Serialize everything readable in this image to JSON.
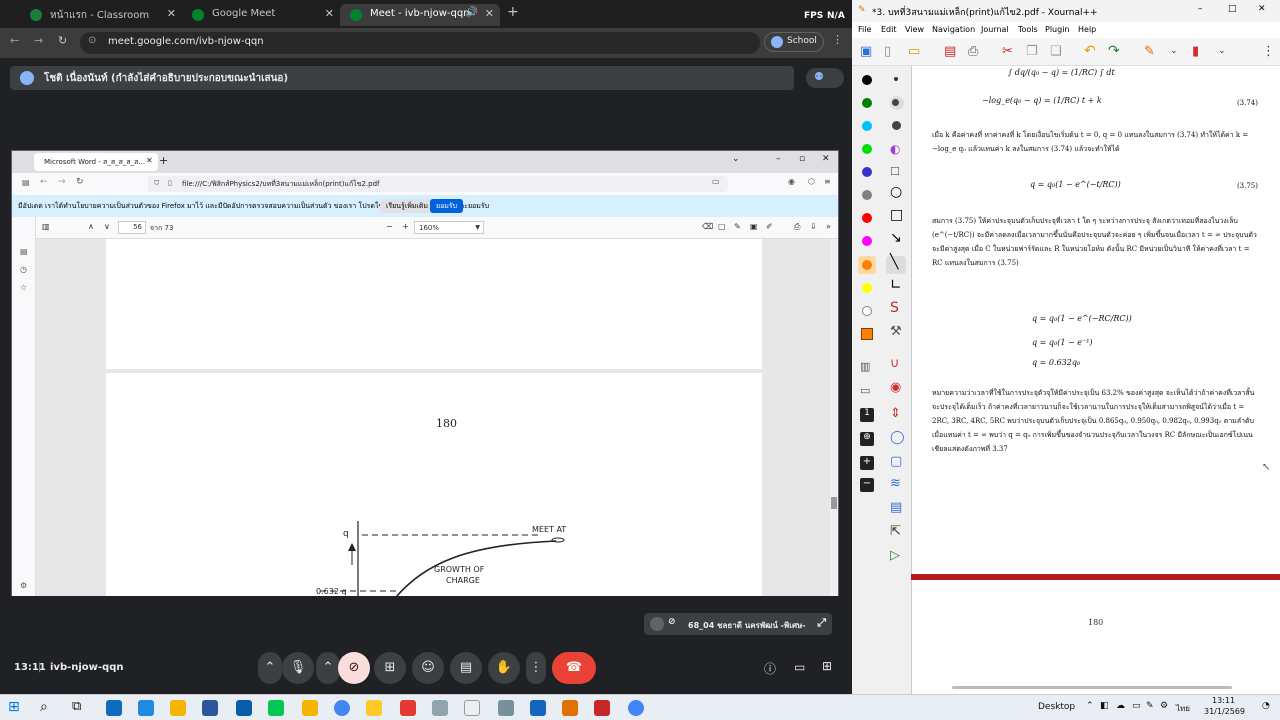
{
  "browser": {
    "tabs": [
      {
        "label": "หน้าแรก - Classroom",
        "fav_color": "#188038"
      },
      {
        "label": "Google Meet",
        "fav_color": "#00832d"
      },
      {
        "label": "Meet - ivb-njow-qqn",
        "fav_color": "#00832d"
      }
    ],
    "new_tab": "+",
    "url": "meet.google.com/ivb-njow-qqn",
    "profile": "School",
    "fps_label": "FPS",
    "fps_value": "N/A"
  },
  "meet": {
    "presenter_banner": "โชติ เนื่องนันท์ (กำลังไส่คำอธิบายประกอบขณะนำเสนอ)",
    "time": "13:11",
    "meeting_code": "ivb-njow-qqn",
    "self_tile": "68_04 ชลธาดี นครพัฒน์ -พิเศษ-"
  },
  "shared_window": {
    "tab_label": "Microsoft Word - ส_ส_ส_ส_ส...",
    "file_url": "file:///C:/ฟิสิกส์Physics2/บทที่3สนามแม่เหล็ก(print)แก้ไข2.pdf",
    "notice": "มีอัปเดต เราได้ทำนโยบายความเป็นส่วนตัวของ Firefox มาไว้ และมีปัดอัปการตรวจสอบความเป็นส่วนตัว ของเรา โปรดใช้เวลาศึกษาเพื่อตรวจสอบและยอมรับ",
    "notice_btn1": "เรียนรู้เพิ่มเติม",
    "notice_btn2": "ยอมรับ",
    "page_num": "56",
    "page_total": "จาก 73",
    "zoom": "160%",
    "page_number_label": "180",
    "graph_label_q0": "q",
    "graph_label_meet": "MEET AT",
    "graph_label_growth": "GROWTH OF",
    "graph_label_charge": "CHARGE",
    "graph_label_0632": "0.632 q"
  },
  "xournal": {
    "title": "*3. บทที่3สนามแม่เหล็ก(print)แก้ไข2.pdf - Xournal++",
    "menu": [
      "File",
      "Edit",
      "View",
      "Navigation",
      "Journal",
      "Tools",
      "Plugin",
      "Help"
    ],
    "page": {
      "eq_top1": "∫ dq/(q₀ − q) = (1/RC) ∫ dt",
      "eq_top2": "−log_e(q₀ − q) = (1/RC) t + k",
      "eq_top2_num": "(3.74)",
      "para1": "เมื่อ k คือค่าคงที่ หาค่าคงที่ k โดยเงื่อนไขเริ่มต้น t = 0, q = 0 แทนลงในสมการ (3.74) ทำให้ได้ค่า k = −log_e q₀ แล้วแทนค่า k ลงในสมการ (3.74) แล้วจะทำให้ได้",
      "eq_375": "q = q₀(1 − e^(−t/RC))",
      "eq_375_num": "(3.75)",
      "para2": "สมการ (3.75) ให้ค่าประจุบนตัวเก็บประจุที่เวลา t ใด ๆ ระหว่างการประจุ สังเกตว่าเทอมที่สองในวงเล็บ (e^(−t/RC)) จะมีค่าลดลงเมื่อเวลามากขึ้นนั่นคือประจุบนตัวจะค่อย ๆ เพิ่มขึ้นจนเมื่อเวลา t = ∞ ประจุบนตัวจะมีค่าสูงสุด เมื่อ C ในหน่วยฟาร์รัดและ R ในหน่วยโอห์ม ดังนั้น RC มีหน่วยเป็นวินาที ให้ค่าคงที่เวลา t = RC แทนลงในสมการ (3.75)",
      "eq_a": "q = q₀(1 − e^(−RC/RC))",
      "eq_b": "q = q₀(1 − e⁻¹)",
      "eq_c": "q = 0.632q₀",
      "para3": "หมายความว่าเวลาที่ใช้ในการประจุตัวจุให้มีค่าประจุเป็น 63.2% ของค่าสูงสุด จะเห็นได้ว่าถ้าค่าคงที่เวลาสั้นจะประจุได้เต็มเร็ว ถ้าค่าคงที่เวลายาวนานก็จะใช้เวลานานในการประจุให้เต็มสามารถพิสูจน์ได้ว่าเมื่อ t = 2RC, 3RC, 4RC, 5RC พบว่าประจุบนตัวเก็บประจุเป็น 0.865q₀, 0.950q₀, 0.982q₀, 0.993q₀ ตามลำดับเมื่อแทนค่า t = ∞ พบว่า q = q₀ การเพิ่มขึ้นของจำนวนประจุกับเวลาในวงจร RC มีลักษณะเป็นเอกซ์โปเนนเชียลแสดงดังภาพที่ 3.37",
      "page_num": "180"
    }
  },
  "taskbar": {
    "desktop_label": "Desktop",
    "clock_time": "13:11",
    "clock_date": "31/1/2569",
    "lang": "ไทย"
  },
  "colors": {
    "meet_bg": "#202124",
    "end_call": "#ea4335",
    "accent_blue": "#8ab4f8",
    "xo_page_divider": "#b71c1c"
  }
}
